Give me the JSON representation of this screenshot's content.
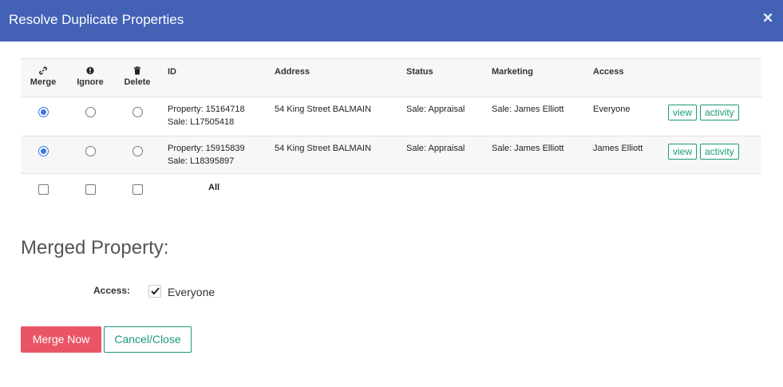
{
  "modal": {
    "title": "Resolve Duplicate Properties",
    "close_icon": "times-icon"
  },
  "table": {
    "headers": {
      "merge": "Merge",
      "ignore": "Ignore",
      "delete": "Delete",
      "id": "ID",
      "address": "Address",
      "status": "Status",
      "marketing": "Marketing",
      "access": "Access"
    },
    "header_icons": {
      "merge": "link-icon",
      "ignore": "exclamation-circle-icon",
      "delete": "trash-icon"
    },
    "rows": [
      {
        "selection": "merge",
        "id_line1": "Property: 15164718",
        "id_line2": "Sale: L17505418",
        "address": "54 King Street BALMAIN",
        "status": "Sale: Appraisal",
        "marketing": "Sale: James Elliott",
        "access": "Everyone",
        "view_label": "view",
        "activity_label": "activity"
      },
      {
        "selection": "merge",
        "id_line1": "Property: 15915839",
        "id_line2": "Sale: L18395897",
        "address": "54 King Street BALMAIN",
        "status": "Sale: Appraisal",
        "marketing": "Sale: James Elliott",
        "access": "James Elliott",
        "view_label": "view",
        "activity_label": "activity"
      }
    ],
    "all_row": {
      "label": "All",
      "merge_checked": false,
      "ignore_checked": false,
      "delete_checked": false
    }
  },
  "merged": {
    "title": "Merged Property:",
    "access_label": "Access:",
    "access_checked": true,
    "access_value": "Everyone"
  },
  "actions": {
    "merge_label": "Merge Now",
    "cancel_label": "Cancel/Close"
  },
  "colors": {
    "header_bg": "#4361b5",
    "accent_green": "#1a9a7a",
    "merge_btn": "#e95567",
    "radio_blue": "#3b78e7"
  }
}
